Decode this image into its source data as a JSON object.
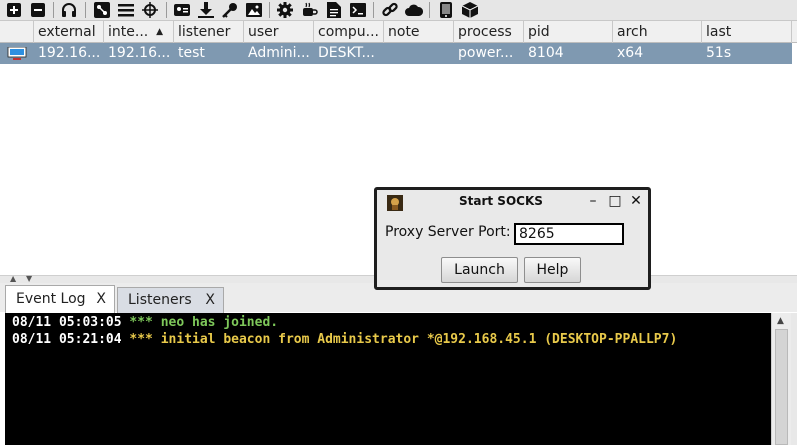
{
  "toolbar": {
    "icons": [
      "plus-icon",
      "minus-icon",
      "headphones-icon",
      "pivot-graph-icon",
      "list-icon",
      "target-icon",
      "id-card-icon",
      "download-icon",
      "key-icon",
      "image-icon",
      "gear-icon",
      "coffee-icon",
      "document-icon",
      "terminal-icon",
      "link-icon",
      "cloud-icon",
      "phone-icon",
      "package-icon"
    ]
  },
  "table": {
    "columns": [
      "external",
      "inte...",
      "listener",
      "user",
      "compu...",
      "note",
      "process",
      "pid",
      "arch",
      "last"
    ],
    "sort_indicator": "▲",
    "rows": [
      {
        "external": "192.16...",
        "internal": "192.16...",
        "listener": "test",
        "user": "Admini...",
        "computer": "DESKT...",
        "note": "",
        "process": "power...",
        "pid": "8104",
        "arch": "x64",
        "last": "51s"
      }
    ]
  },
  "tabs": [
    {
      "label": "Event Log",
      "close": "X"
    },
    {
      "label": "Listeners",
      "close": "X"
    }
  ],
  "console": {
    "lines": [
      {
        "time": "08/11 05:03:05",
        "stars": "***",
        "text": "neo has joined."
      },
      {
        "time": "08/11 05:21:04",
        "stars": "***",
        "text": "initial beacon from Administrator *@192.168.45.1 (DESKTOP-PPALLP7)"
      }
    ]
  },
  "dialog": {
    "title": "Start SOCKS",
    "port_label": "Proxy Server Port:",
    "port_value": "8265",
    "launch_label": "Launch",
    "help_label": "Help",
    "min_glyph": "–",
    "max_glyph": "□",
    "close_glyph": "✕"
  },
  "colors": {
    "selected_row": "#7f99b1",
    "console_bg": "#000000",
    "console_time": "#ffffff",
    "console_join": "#7ec85a",
    "console_beacon": "#e8c94a"
  }
}
